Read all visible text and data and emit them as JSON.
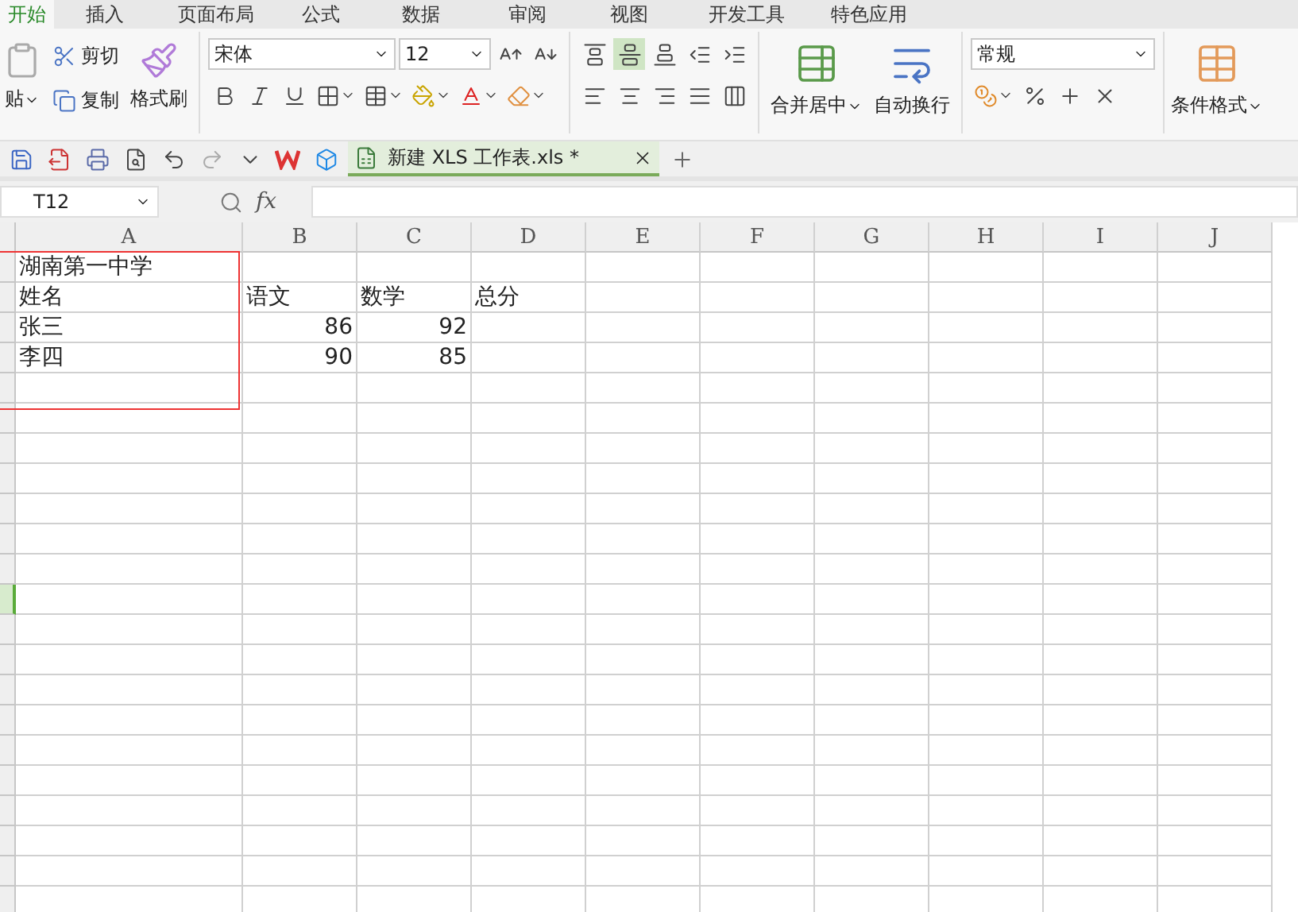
{
  "menu_tabs": [
    {
      "label": "开始",
      "selected": true
    },
    {
      "label": "插入",
      "selected": false
    },
    {
      "label": "页面布局",
      "selected": false
    },
    {
      "label": "公式",
      "selected": false
    },
    {
      "label": "数据",
      "selected": false
    },
    {
      "label": "审阅",
      "selected": false
    },
    {
      "label": "视图",
      "selected": false
    },
    {
      "label": "开发工具",
      "selected": false
    },
    {
      "label": "特色应用",
      "selected": false
    }
  ],
  "clipboard": {
    "paste": "贴",
    "cut": "剪切",
    "copy": "复制",
    "format_painter": "格式刷"
  },
  "font": {
    "name": "宋体",
    "size": "12"
  },
  "align_top": [
    {
      "kind": "top",
      "selected": false
    },
    {
      "kind": "middle",
      "selected": true
    },
    {
      "kind": "bottom",
      "selected": false
    },
    {
      "kind": "outdent",
      "selected": false
    },
    {
      "kind": "indent",
      "selected": false
    }
  ],
  "align_bottom": [
    {
      "kind": "left",
      "selected": false
    },
    {
      "kind": "center",
      "selected": false
    },
    {
      "kind": "right",
      "selected": false
    },
    {
      "kind": "justify",
      "selected": false
    },
    {
      "kind": "distributed",
      "selected": false
    }
  ],
  "merge": "合并居中",
  "wrap": "自动换行",
  "number_format": "常规",
  "conditional": "条件格式",
  "doc_tab": {
    "title": "新建 XLS 工作表.xls *",
    "selected": true
  },
  "formula_bar": {
    "name_box": "T12",
    "fx": "fx"
  },
  "columns": [
    "A",
    "B",
    "C",
    "D",
    "E",
    "F",
    "G",
    "H",
    "I",
    "J"
  ],
  "rows": [
    {
      "selected": false,
      "cells": [
        {
          "text": "湖南第一中学",
          "kind": "text"
        }
      ]
    },
    {
      "selected": false,
      "cells": [
        {
          "text": "姓名",
          "kind": "text"
        },
        {
          "text": "语文",
          "kind": "text"
        },
        {
          "text": "数学",
          "kind": "text"
        },
        {
          "text": "总分",
          "kind": "text"
        }
      ]
    },
    {
      "selected": false,
      "cells": [
        {
          "text": "张三",
          "kind": "text"
        },
        {
          "text": "86",
          "kind": "number"
        },
        {
          "text": "92",
          "kind": "number"
        }
      ]
    },
    {
      "selected": false,
      "cells": [
        {
          "text": "李四",
          "kind": "text"
        },
        {
          "text": "90",
          "kind": "number"
        },
        {
          "text": "85",
          "kind": "number"
        }
      ]
    },
    {
      "selected": false
    },
    {
      "selected": false
    },
    {
      "selected": false
    },
    {
      "selected": false
    },
    {
      "selected": false
    },
    {
      "selected": false
    },
    {
      "selected": false
    },
    {
      "selected": true
    },
    {
      "selected": false
    },
    {
      "selected": false
    },
    {
      "selected": false
    },
    {
      "selected": false
    },
    {
      "selected": false
    },
    {
      "selected": false
    },
    {
      "selected": false
    },
    {
      "selected": false
    },
    {
      "selected": false
    },
    {
      "selected": false
    }
  ]
}
